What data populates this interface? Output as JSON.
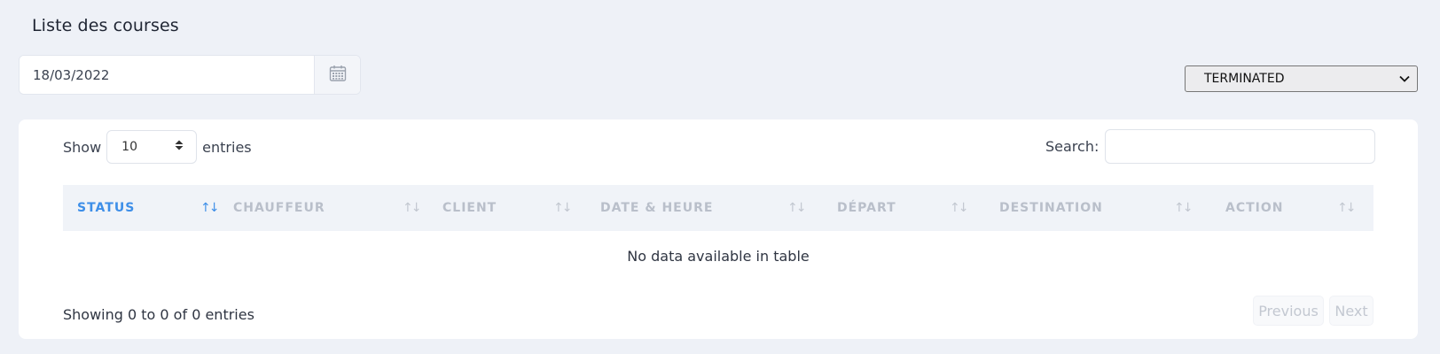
{
  "page": {
    "title": "Liste des courses"
  },
  "filters": {
    "date_value": "18/03/2022",
    "date_icon": "calendar-icon",
    "status_selected": "TERMINATED"
  },
  "table_controls": {
    "show_label": "Show",
    "length_value": "10",
    "entries_label": "entries",
    "search_label": "Search:",
    "search_value": ""
  },
  "table": {
    "columns": [
      "STATUS",
      "CHAUFFEUR",
      "CLIENT",
      "DATE & HEURE",
      "DÉPART",
      "DESTINATION",
      "ACTION"
    ],
    "sorted_column": "STATUS",
    "empty_message": "No data available in table"
  },
  "footer": {
    "info": "Showing 0 to 0 of 0 entries",
    "previous_label": "Previous",
    "next_label": "Next"
  },
  "colors": {
    "background": "#eef1f7",
    "accent": "#3d8ee8",
    "header_bg": "#f0f3f8"
  }
}
